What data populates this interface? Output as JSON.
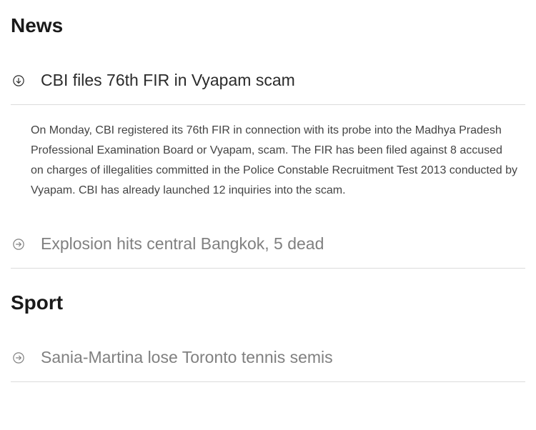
{
  "sections": {
    "news": {
      "title": "News",
      "items": [
        {
          "title": "CBI files 76th FIR in Vyapam scam",
          "expanded": true,
          "content": "On Monday, CBI registered its 76th FIR in connection with its probe into the Madhya Pradesh Professional Examination Board or Vyapam, scam. The FIR has been filed against 8 accused on charges of illegalities committed in the Police Constable Recruitment Test 2013 conducted by Vyapam. CBI has already launched 12 inquiries into the scam."
        },
        {
          "title": "Explosion hits central Bangkok, 5 dead",
          "expanded": false
        }
      ]
    },
    "sport": {
      "title": "Sport",
      "items": [
        {
          "title": "Sania-Martina lose Toronto tennis semis",
          "expanded": false
        }
      ]
    }
  }
}
